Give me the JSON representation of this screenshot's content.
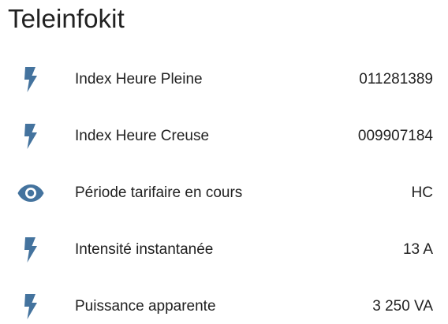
{
  "card": {
    "title": "Teleinfokit"
  },
  "colors": {
    "icon": "#44739e",
    "text": "#212121",
    "background": "#ffffff"
  },
  "rows": [
    {
      "icon": "flash-icon",
      "label": "Index Heure Pleine",
      "value": "011281389"
    },
    {
      "icon": "flash-icon",
      "label": "Index Heure Creuse",
      "value": "009907184"
    },
    {
      "icon": "eye-icon",
      "label": "Période tarifaire en cours",
      "value": "HC"
    },
    {
      "icon": "flash-icon",
      "label": "Intensité instantanée",
      "value": "13 A"
    },
    {
      "icon": "flash-icon",
      "label": "Puissance apparente",
      "value": "3 250 VA"
    }
  ]
}
